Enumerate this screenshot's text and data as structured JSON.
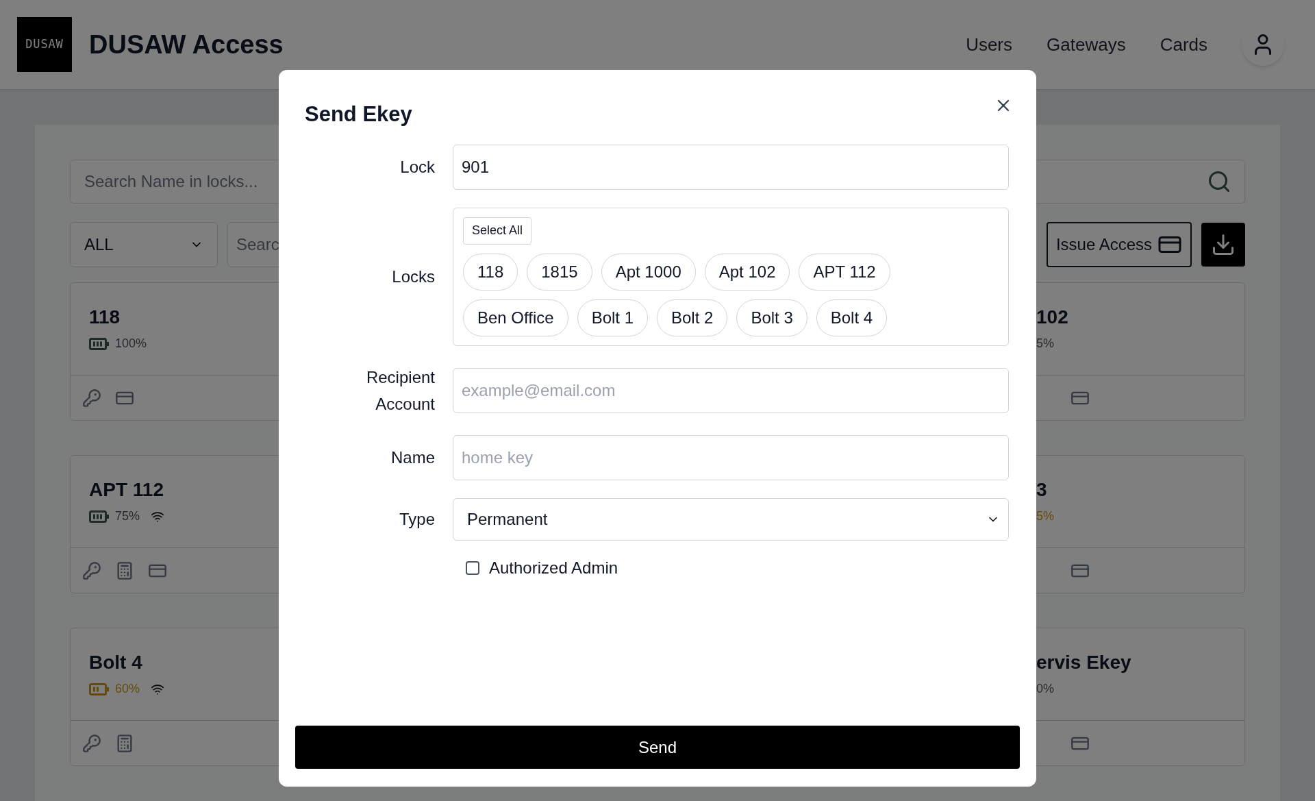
{
  "header": {
    "logo": "DUSAW",
    "title": "DUSAW Access",
    "nav": [
      {
        "label": "Users"
      },
      {
        "label": "Gateways"
      },
      {
        "label": "Cards"
      }
    ]
  },
  "toolbar": {
    "search": {
      "placeholder": "Search Name in locks..."
    },
    "filter": {
      "value": "ALL"
    },
    "search_2": {
      "placeholder": "Searc"
    },
    "issue_button": "Issue Access"
  },
  "lock_cards": [
    {
      "kind": "full",
      "name": "118",
      "battery": "100%",
      "battery_low": false,
      "wifi": false,
      "keypad": false,
      "card": true
    },
    {
      "kind": "clipped",
      "name": "102",
      "battery": "5%",
      "battery_low": false,
      "card": true
    },
    {
      "kind": "full",
      "name": "APT 112",
      "battery": "75%",
      "battery_low": false,
      "wifi": true,
      "keypad": true,
      "card": true
    },
    {
      "kind": "clipped",
      "name": "3",
      "battery": "5%",
      "battery_low": true,
      "card": true
    },
    {
      "kind": "full",
      "name": "Bolt 4",
      "battery": "60%",
      "battery_low": true,
      "wifi": true,
      "keypad": true,
      "card": false
    },
    {
      "kind": "clipped",
      "name": "ervis Ekey",
      "battery": "0%",
      "battery_low": false,
      "card": true
    }
  ],
  "dialog": {
    "title": "Send Ekey",
    "fields": [
      {
        "kind": "text",
        "label": "Lock",
        "value": "901"
      },
      {
        "kind": "chips",
        "label": "Locks",
        "select_all": "Select All",
        "chips": [
          {
            "label": "118",
            "selected": false
          },
          {
            "label": "1815",
            "selected": false
          },
          {
            "label": "Apt 1000",
            "selected": false
          },
          {
            "label": "Apt 102",
            "selected": false
          },
          {
            "label": "APT 112",
            "selected": false
          },
          {
            "label": "Ben Office",
            "selected": false
          },
          {
            "label": "Bolt 1",
            "selected": false
          },
          {
            "label": "Bolt 2",
            "selected": false
          },
          {
            "label": "Bolt 3",
            "selected": false
          },
          {
            "label": "Bolt 4",
            "selected": false
          }
        ]
      },
      {
        "kind": "text",
        "label": "Recipient Account",
        "placeholder": "example@email.com"
      },
      {
        "kind": "text",
        "label": "Name",
        "placeholder": "home key"
      },
      {
        "kind": "select",
        "label": "Type",
        "value": "Permanent"
      }
    ],
    "checkbox": {
      "label": "Authorized Admin",
      "checked": false
    },
    "submit": "Send"
  }
}
